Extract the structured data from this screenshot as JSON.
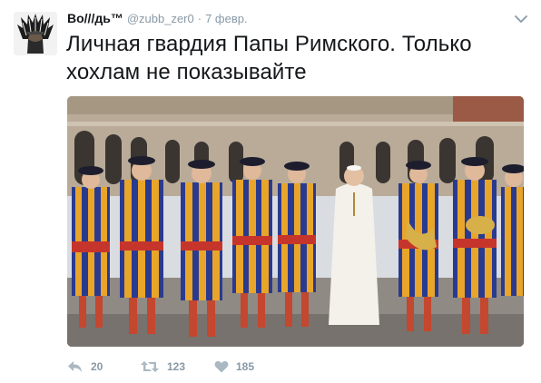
{
  "tweet": {
    "author": {
      "display_name": "Во///дь™",
      "handle": "@zubb_zer0",
      "avatar_icon": "avatar-native-headdress"
    },
    "separator": "·",
    "date": "7 февр.",
    "text": "Личная гвардия Папы Римского. Только хохлам не показывайте",
    "media": {
      "type": "photo",
      "icon": "photo-swiss-guard-band-with-pope"
    },
    "actions": {
      "reply": {
        "icon": "reply-icon",
        "count": "20"
      },
      "retweet": {
        "icon": "retweet-icon",
        "count": "123"
      },
      "like": {
        "icon": "heart-icon",
        "count": "185"
      }
    }
  },
  "colors": {
    "text": "#14171a",
    "muted": "#8899a6",
    "icon": "#aab8c2",
    "background": "#ffffff"
  }
}
